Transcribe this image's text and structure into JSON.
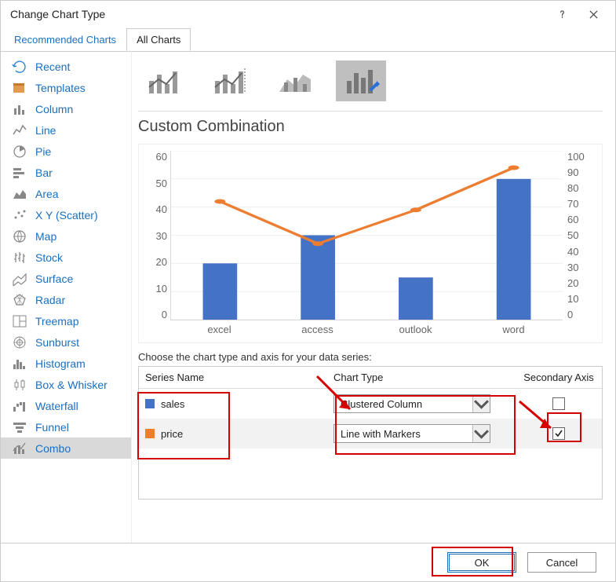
{
  "title": "Change Chart Type",
  "tabs": {
    "recommended": "Recommended Charts",
    "all": "All Charts"
  },
  "sidebar": {
    "items": [
      {
        "label": "Recent",
        "icon": "recent"
      },
      {
        "label": "Templates",
        "icon": "templates"
      },
      {
        "label": "Column",
        "icon": "column"
      },
      {
        "label": "Line",
        "icon": "line"
      },
      {
        "label": "Pie",
        "icon": "pie"
      },
      {
        "label": "Bar",
        "icon": "bar"
      },
      {
        "label": "Area",
        "icon": "area"
      },
      {
        "label": "X Y (Scatter)",
        "icon": "scatter"
      },
      {
        "label": "Map",
        "icon": "map"
      },
      {
        "label": "Stock",
        "icon": "stock"
      },
      {
        "label": "Surface",
        "icon": "surface"
      },
      {
        "label": "Radar",
        "icon": "radar"
      },
      {
        "label": "Treemap",
        "icon": "treemap"
      },
      {
        "label": "Sunburst",
        "icon": "sunburst"
      },
      {
        "label": "Histogram",
        "icon": "histogram"
      },
      {
        "label": "Box & Whisker",
        "icon": "boxwhisker"
      },
      {
        "label": "Waterfall",
        "icon": "waterfall"
      },
      {
        "label": "Funnel",
        "icon": "funnel"
      },
      {
        "label": "Combo",
        "icon": "combo"
      }
    ]
  },
  "section_title": "Custom Combination",
  "choose_label": "Choose the chart type and axis for your data series:",
  "table": {
    "head_name": "Series Name",
    "head_type": "Chart Type",
    "head_axis": "Secondary Axis",
    "rows": [
      {
        "name": "sales",
        "type": "Clustered Column",
        "secondary": false,
        "color": "#4472c4"
      },
      {
        "name": "price",
        "type": "Line with Markers",
        "secondary": true,
        "color": "#ed7d31"
      }
    ]
  },
  "buttons": {
    "ok": "OK",
    "cancel": "Cancel"
  },
  "chart_data": {
    "type": "combo",
    "categories": [
      "excel",
      "access",
      "outlook",
      "word"
    ],
    "series": [
      {
        "name": "sales",
        "type": "bar",
        "axis": "left",
        "color": "#4472c4",
        "values": [
          20,
          30,
          15,
          50
        ]
      },
      {
        "name": "price",
        "type": "line",
        "axis": "right",
        "color": "#ed7d31",
        "values": [
          70,
          45,
          65,
          90
        ]
      }
    ],
    "ylim_left": {
      "min": 0,
      "max": 60,
      "ticks": [
        0,
        10,
        20,
        30,
        40,
        50,
        60
      ]
    },
    "ylim_right": {
      "min": 0,
      "max": 100,
      "ticks": [
        0,
        10,
        20,
        30,
        40,
        50,
        60,
        70,
        80,
        90,
        100
      ]
    }
  }
}
